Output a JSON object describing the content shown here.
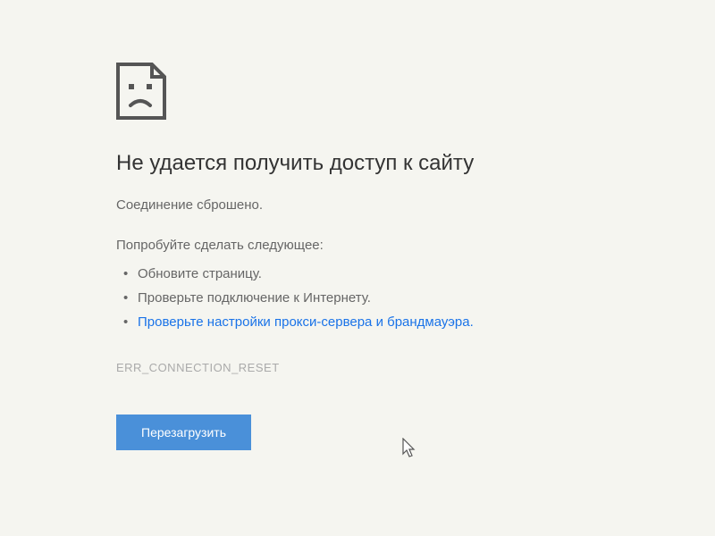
{
  "error": {
    "title": "Не удается получить доступ к сайту",
    "message": "Соединение сброшено.",
    "suggestions_intro": "Попробуйте сделать следующее:",
    "suggestions": [
      "Обновите страницу.",
      "Проверьте подключение к Интернету.",
      "Проверьте настройки прокси-сервера и брандмауэра."
    ],
    "code": "ERR_CONNECTION_RESET",
    "reload_button": "Перезагрузить"
  },
  "icons": {
    "sad_page": "sad-page-icon",
    "cursor": "cursor-arrow"
  }
}
